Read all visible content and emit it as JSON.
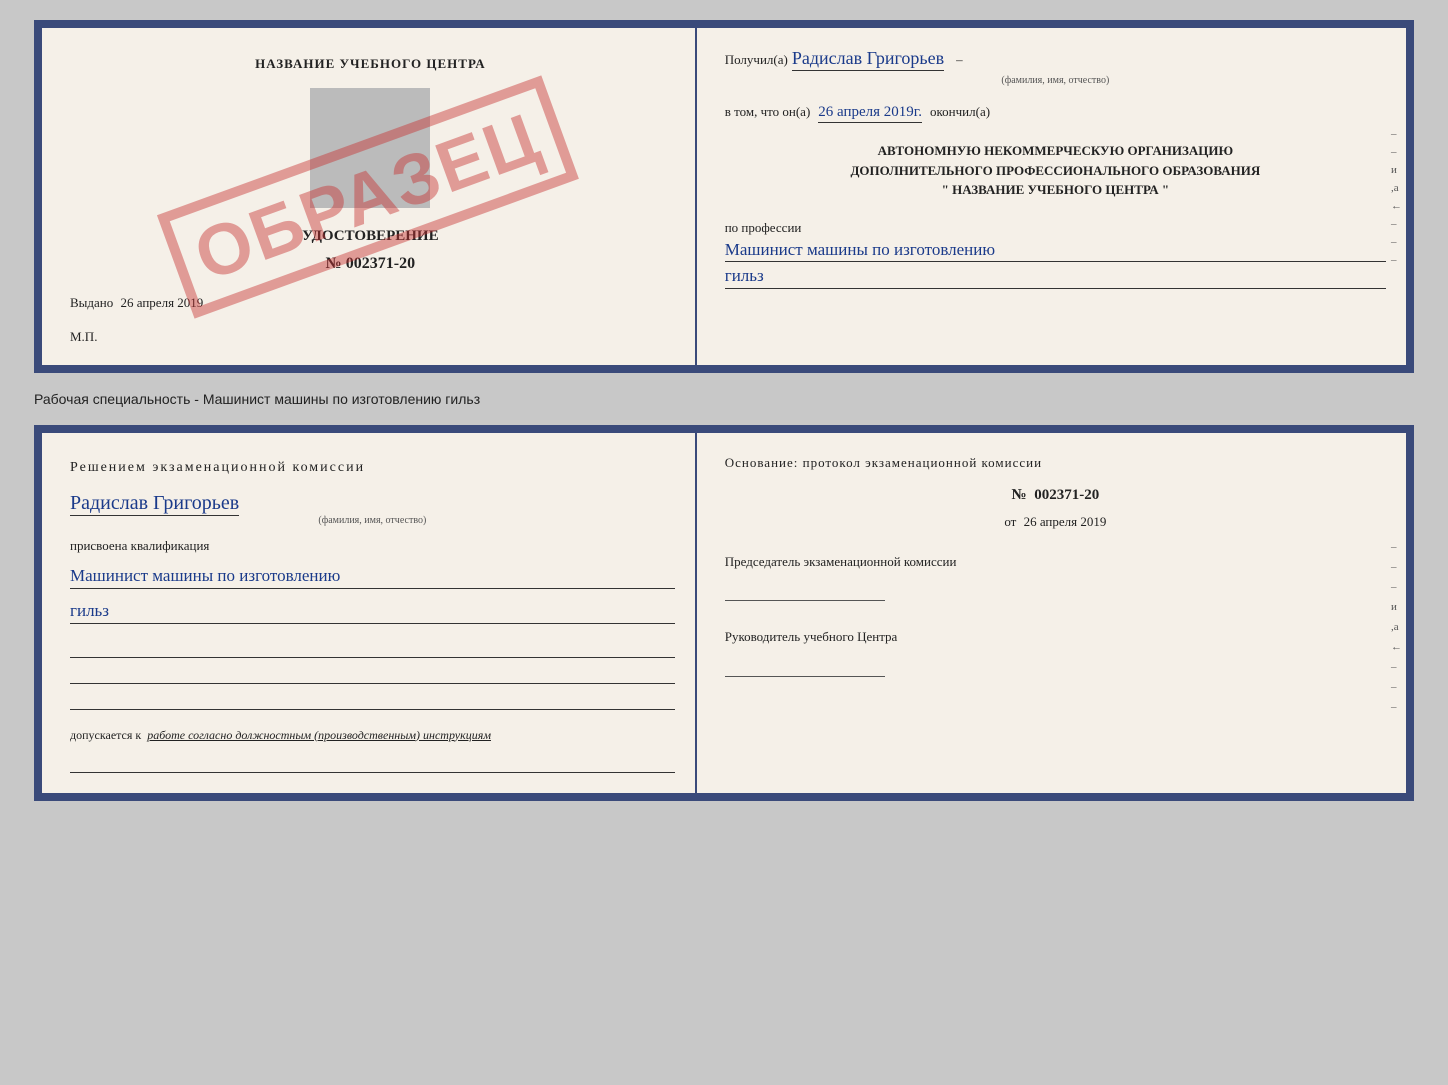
{
  "top_doc": {
    "left": {
      "title": "НАЗВАНИЕ УЧЕБНОГО ЦЕНТРА",
      "stamp_text": "ОБРАЗЕЦ",
      "cert_title": "УДОСТОВЕРЕНИЕ",
      "cert_number": "№ 002371-20",
      "issued_label": "Выдано",
      "issued_date": "26 апреля 2019",
      "mp_label": "М.П."
    },
    "right": {
      "received_prefix": "Получил(а)",
      "recipient_name": "Радислав Григорьев",
      "fio_label": "(фамилия, имя, отчество)",
      "in_that_prefix": "в том, что он(а)",
      "completion_date": "26 апреля 2019г.",
      "finished_label": "окончил(а)",
      "org_line1": "АВТОНОМНУЮ НЕКОММЕРЧЕСКУЮ ОРГАНИЗАЦИЮ",
      "org_line2": "ДОПОЛНИТЕЛЬНОГО ПРОФЕССИОНАЛЬНОГО ОБРАЗОВАНИЯ",
      "org_quote_open": "\"",
      "org_name": "НАЗВАНИЕ УЧЕБНОГО ЦЕНТРА",
      "org_quote_close": "\"",
      "profession_prefix": "по профессии",
      "profession_text": "Машинист машины по изготовлению",
      "profession_text2": "гильз",
      "side_marks": [
        "-",
        "-",
        "и",
        "а",
        "←",
        "-",
        "-",
        "-"
      ]
    }
  },
  "caption": "Рабочая специальность - Машинист машины по изготовлению гильз",
  "bottom_doc": {
    "left": {
      "decision_text": "Решением  экзаменационной  комиссии",
      "name_text": "Радислав Григорьев",
      "fio_label": "(фамилия, имя, отчество)",
      "qualification_prefix": "присвоена квалификация",
      "qualification_text": "Машинист машины по изготовлению",
      "qualification_text2": "гильз",
      "allowed_prefix": "допускается к",
      "allowed_text": "работе согласно должностным (производственным) инструкциям"
    },
    "right": {
      "basis_text": "Основание: протокол экзаменационной  комиссии",
      "number_prefix": "№",
      "number_value": "002371-20",
      "date_prefix": "от",
      "date_value": "26 апреля 2019",
      "chairman_label": "Председатель экзаменационной комиссии",
      "head_label": "Руководитель учебного Центра",
      "side_marks": [
        "-",
        "-",
        "-",
        "и",
        "а",
        "←",
        "-",
        "-",
        "-"
      ]
    }
  }
}
